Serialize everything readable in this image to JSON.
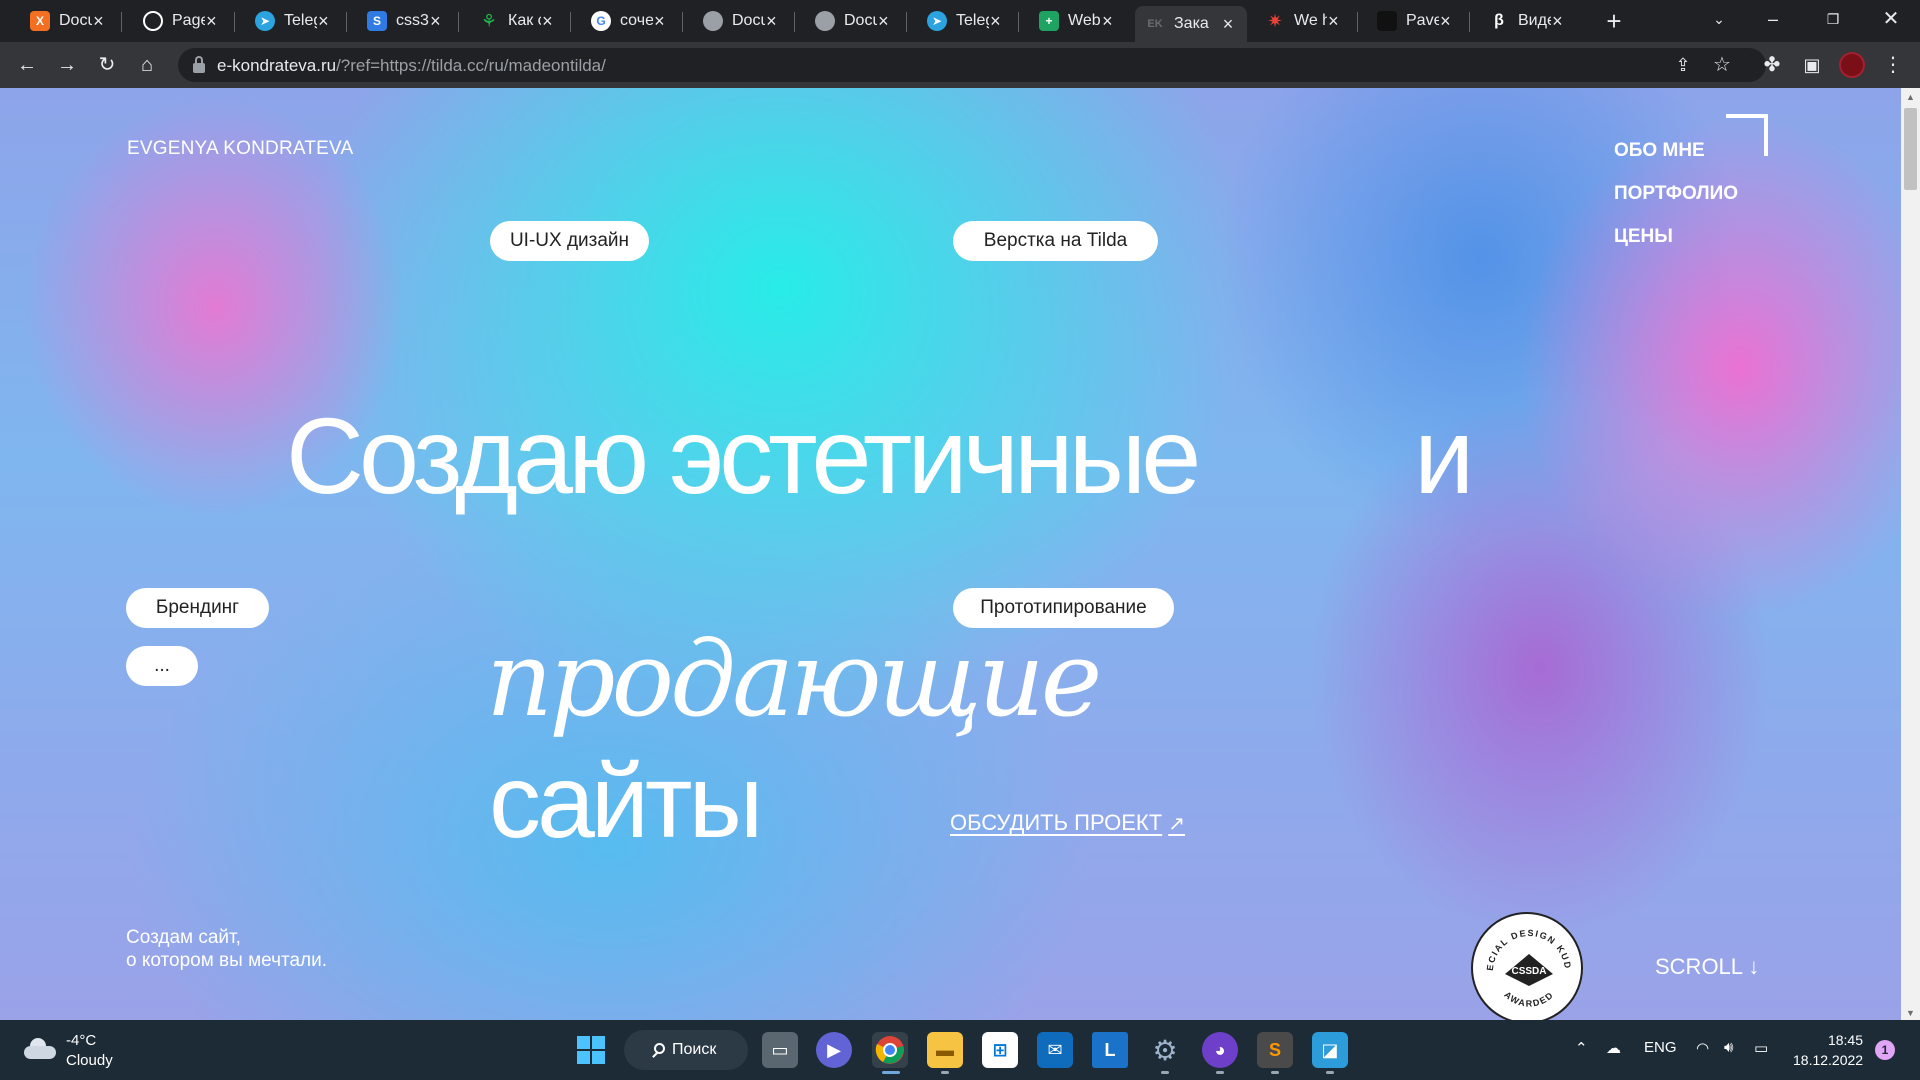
{
  "browser": {
    "tabs": [
      {
        "title": "Docu",
        "icon": "xampp-icon",
        "color": "#f36f21"
      },
      {
        "title": "Page",
        "icon": "github-icon",
        "color": "#ffffff"
      },
      {
        "title": "Teleg",
        "icon": "telegram-icon",
        "color": "#2aa3df"
      },
      {
        "title": "css3",
        "icon": "stackoverflow-icon",
        "color": "#2f7be3"
      },
      {
        "title": "Как с",
        "icon": "plant-icon",
        "color": "#1db94a"
      },
      {
        "title": "соче",
        "icon": "google-icon",
        "color": "#4285f4"
      },
      {
        "title": "Docu",
        "icon": "globe-icon",
        "color": "#9aa0a6"
      },
      {
        "title": "Docu",
        "icon": "globe-icon",
        "color": "#9aa0a6"
      },
      {
        "title": "Teleg",
        "icon": "telegram-icon",
        "color": "#2aa3df"
      },
      {
        "title": "Web",
        "icon": "sheets-icon",
        "color": "#1ea362"
      },
      {
        "title": "Зака",
        "icon": "ek-logo-icon",
        "color": "#6b6b6b",
        "active": true
      },
      {
        "title": "We h",
        "icon": "star-burst-icon",
        "color": "#ea4335"
      },
      {
        "title": "Pave",
        "icon": "dark-square-icon",
        "color": "#111111"
      },
      {
        "title": "Виде",
        "icon": "beta-icon",
        "color": "#ffffff"
      }
    ],
    "url_host": "e-kondrateva.ru",
    "url_path": "/?ref=https://tilda.cc/ru/madeontilda/"
  },
  "site": {
    "logo": "EVGENYA KONDRATEVA",
    "nav": [
      "ОБО МНЕ",
      "ПОРТФОЛИО",
      "ЦЕНЫ"
    ],
    "pills": {
      "uiux": "UI-UX дизайн",
      "tilda": "Верстка на Tilda",
      "branding": "Брендинг",
      "more": "...",
      "prototype": "Прототипирование"
    },
    "hero": {
      "line1": "Создаю эстетичные",
      "and": "и",
      "italic": "продающие",
      "line3": "сайты"
    },
    "cta": "ОБСУДИТЬ ПРОЕКТ",
    "cta_arrow": "↗",
    "subtext": [
      "Создам сайт,",
      "о котором вы мечтали."
    ],
    "badge": {
      "top": "SPECIAL DESIGN KUDOS",
      "mid": "CSSDA",
      "bottom": "AWARDED"
    },
    "scroll": "SCROLL ↓"
  },
  "taskbar": {
    "temp": "-4°C",
    "condition": "Cloudy",
    "search": "Поиск",
    "lang": "ENG",
    "time": "18:45",
    "date": "18.12.2022",
    "notifications": "1"
  }
}
